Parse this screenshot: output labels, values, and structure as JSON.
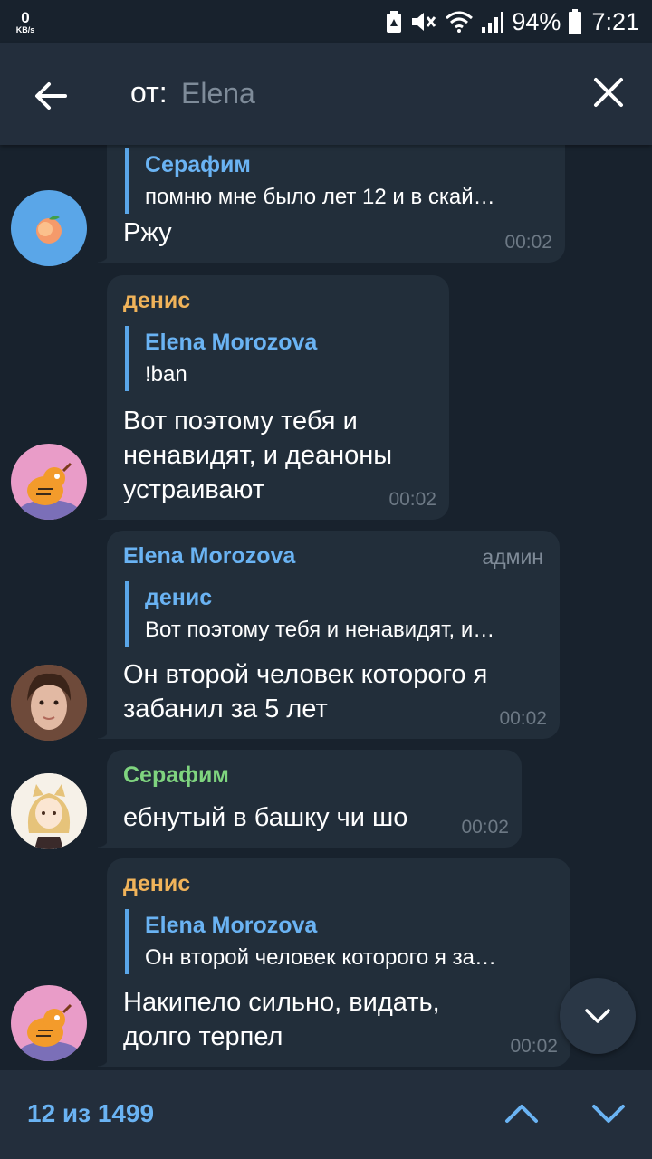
{
  "status_bar": {
    "net_speed": "0",
    "net_unit": "KB/s",
    "battery": "94%",
    "time": "7:21"
  },
  "header": {
    "prefix": "от:",
    "query": "Elena"
  },
  "messages": [
    {
      "reply_name": "Серафим",
      "reply_text": "помню мне было лет 12 и в скай…",
      "text": "Ржу",
      "time": "00:02"
    },
    {
      "sender": "денис",
      "reply_name": "Elena Morozova",
      "reply_text": "!ban",
      "text_lines": [
        "Вот поэтому тебя и",
        "ненавидят, и деаноны",
        "устраивают"
      ],
      "time": "00:02"
    },
    {
      "sender": "Elena Morozova",
      "badge": "админ",
      "reply_name": "денис",
      "reply_text": "Вот поэтому тебя и ненавидят, и…",
      "text_lines": [
        "Он второй человек которого я",
        "забанил за 5 лет"
      ],
      "time": "00:02"
    },
    {
      "sender": "Серафим",
      "text": "ебнутый в башку чи шо",
      "time": "00:02"
    },
    {
      "sender": "денис",
      "reply_name": "Elena Morozova",
      "reply_text": "Он второй человек которого я за…",
      "text_lines": [
        "Накипело сильно, видать,",
        "долго терпел"
      ],
      "time": "00:02"
    }
  ],
  "bottom": {
    "counter": "12 из 1499"
  },
  "colors": {
    "background": "#18222d",
    "header": "#232e3c",
    "bubble": "#222e3a",
    "accent": "#6ab3f3",
    "sender_denis": "#f0b35a",
    "sender_elena": "#6ab3f3",
    "sender_serafim": "#7fd47f"
  },
  "icons": [
    "back-arrow-icon",
    "close-icon",
    "chevron-up-icon",
    "chevron-down-icon"
  ]
}
